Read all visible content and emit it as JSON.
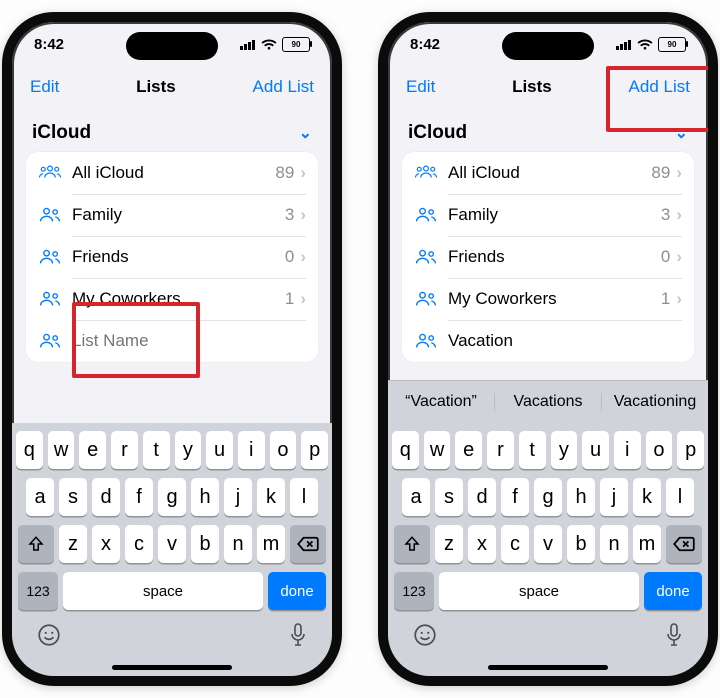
{
  "colors": {
    "accent": "#007aff",
    "highlight": "#d7262b"
  },
  "phones": [
    {
      "status": {
        "time": "8:42",
        "battery": "90"
      },
      "nav": {
        "left": "Edit",
        "title": "Lists",
        "right": "Add List"
      },
      "section": {
        "title": "iCloud"
      },
      "rows": [
        {
          "label": "All iCloud",
          "count": "89",
          "icon": "three"
        },
        {
          "label": "Family",
          "count": "3",
          "icon": "two"
        },
        {
          "label": "Friends",
          "count": "0",
          "icon": "two"
        },
        {
          "label": "My Coworkers",
          "count": "1",
          "icon": "two"
        }
      ],
      "input": {
        "value": "",
        "placeholder": "List Name"
      },
      "show_predictive": false,
      "highlight": "input"
    },
    {
      "status": {
        "time": "8:42",
        "battery": "90"
      },
      "nav": {
        "left": "Edit",
        "title": "Lists",
        "right": "Add List"
      },
      "section": {
        "title": "iCloud"
      },
      "rows": [
        {
          "label": "All iCloud",
          "count": "89",
          "icon": "three"
        },
        {
          "label": "Family",
          "count": "3",
          "icon": "two"
        },
        {
          "label": "Friends",
          "count": "0",
          "icon": "two"
        },
        {
          "label": "My Coworkers",
          "count": "1",
          "icon": "two"
        }
      ],
      "input": {
        "value": "Vacation",
        "placeholder": "List Name"
      },
      "show_predictive": true,
      "predictive": [
        "“Vacation”",
        "Vacations",
        "Vacationing"
      ],
      "highlight": "addlist"
    }
  ],
  "keyboard": {
    "row1": [
      "q",
      "w",
      "e",
      "r",
      "t",
      "y",
      "u",
      "i",
      "o",
      "p"
    ],
    "row2": [
      "a",
      "s",
      "d",
      "f",
      "g",
      "h",
      "j",
      "k",
      "l"
    ],
    "row3": [
      "z",
      "x",
      "c",
      "v",
      "b",
      "n",
      "m"
    ],
    "numbers": "123",
    "space": "space",
    "done": "done"
  }
}
